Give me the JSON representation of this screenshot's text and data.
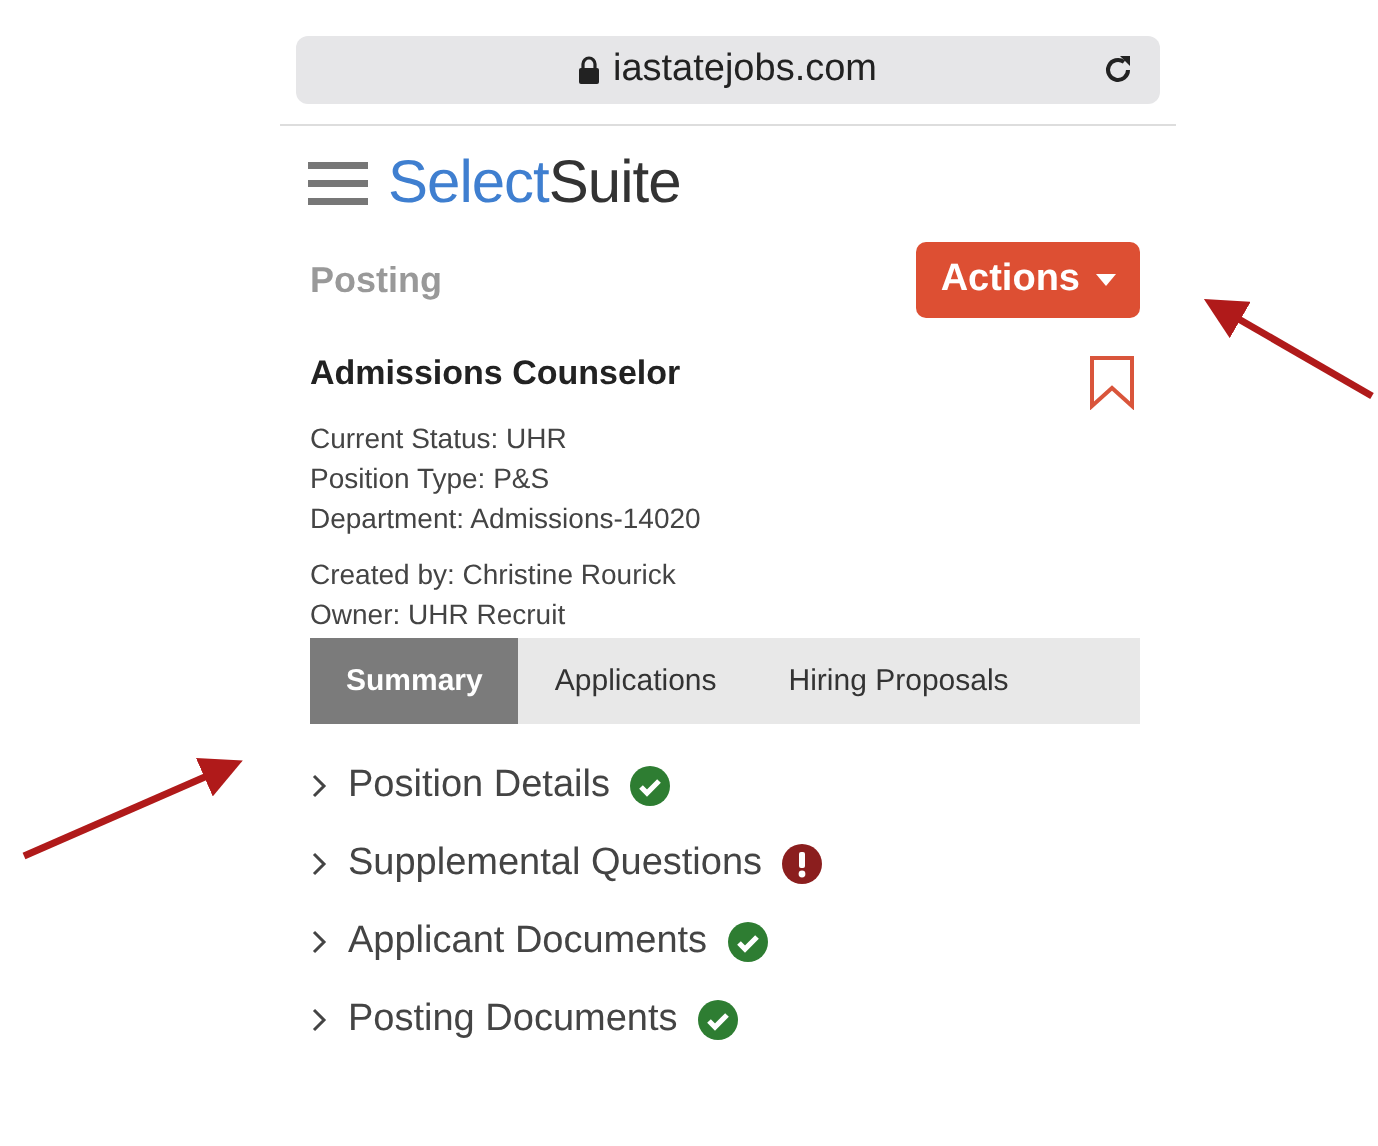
{
  "browser": {
    "address": "iastatejobs.com"
  },
  "header": {
    "logo_first": "Select",
    "logo_second": "Suite"
  },
  "page": {
    "label": "Posting",
    "actions_button": "Actions",
    "title": "Admissions Counselor",
    "bookmarked": false
  },
  "details": [
    "Current Status: UHR",
    "Position Type: P&S",
    "Department: Admissions-14020"
  ],
  "ownership": [
    "Created by: Christine Rourick",
    "Owner: UHR Recruit"
  ],
  "tabs": [
    {
      "label": "Summary",
      "selected": true
    },
    {
      "label": "Applications",
      "selected": false
    },
    {
      "label": "Hiring Proposals",
      "selected": false
    }
  ],
  "sections": [
    {
      "title": "Position Details",
      "kind": "complete",
      "expanded": false
    },
    {
      "title": "Supplemental Questions",
      "kind": "attention",
      "expanded": false
    },
    {
      "title": "Applicant Documents",
      "kind": "complete",
      "expanded": false
    },
    {
      "title": "Posting Documents",
      "kind": "complete",
      "expanded": false
    }
  ]
}
